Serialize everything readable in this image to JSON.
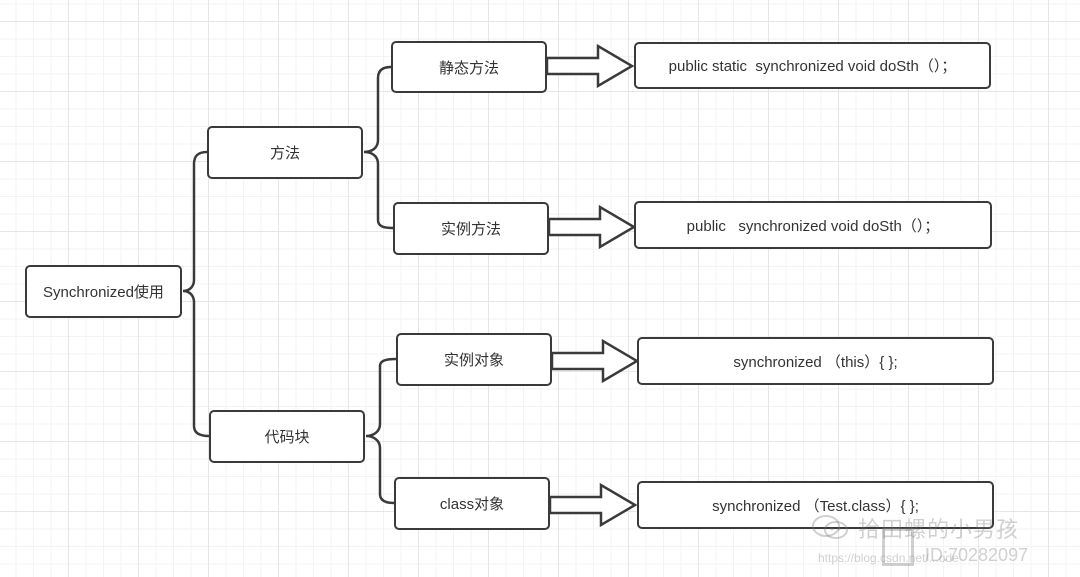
{
  "diagram": {
    "root": {
      "label": "Synchronized使用"
    },
    "branches": [
      {
        "label": "方法",
        "children": [
          {
            "label": "静态方法",
            "code": "public static  synchronized void doSth（）；"
          },
          {
            "label": "实例方法",
            "code": "public   synchronized void doSth（）；"
          }
        ]
      },
      {
        "label": "代码块",
        "children": [
          {
            "label": "实例对象",
            "code": "synchronized （this）{ };"
          },
          {
            "label": "class对象",
            "code": "synchronized （Test.class）{ };"
          }
        ]
      }
    ],
    "colors": {
      "stroke": "#3a3a3a",
      "text": "#333333",
      "grid": "#e6e6e6",
      "background": "#ffffff"
    }
  },
  "watermark": {
    "name": "拾田螺的小男孩",
    "id": "ID:70282097",
    "url": "https://blog.csdn.net/...ode",
    "icon": "wechat-icon"
  }
}
